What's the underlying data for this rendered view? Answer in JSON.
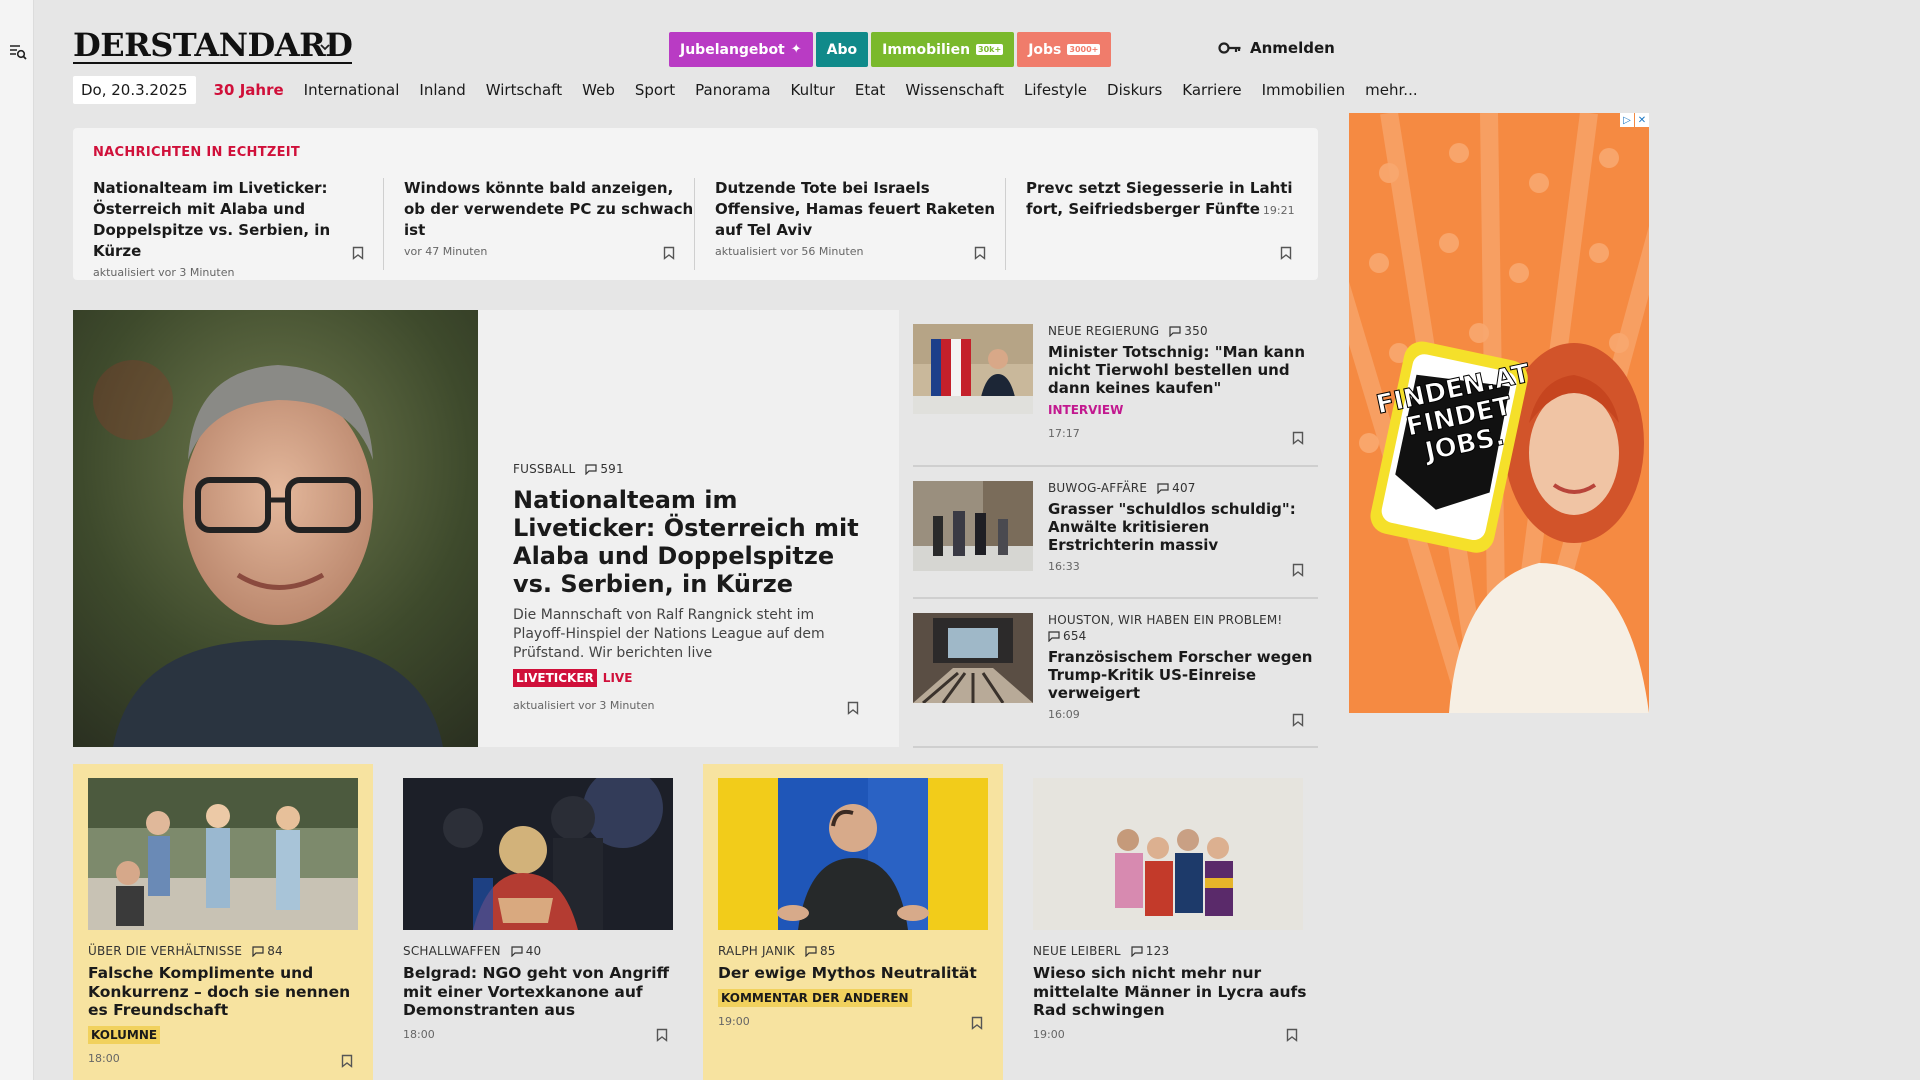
{
  "colors": {
    "accent": "#d0103a",
    "jubel": "#b93bc4",
    "abo": "#108a8a",
    "immo": "#7ab92c",
    "jobs": "#f07c6b",
    "interview": "#c2188f",
    "kolumne_bg": "#f7e3a0"
  },
  "header": {
    "logo": "DERSTANDARD",
    "buttons": {
      "jubel": "Jubelangebot",
      "abo": "Abo",
      "immo": "Immobilien",
      "immo_tag": "30k+",
      "jobs": "Jobs",
      "jobs_tag": "3000+"
    },
    "login": "Anmelden"
  },
  "nav": {
    "date": "Do, 20.3.2025",
    "items": [
      "30 Jahre",
      "International",
      "Inland",
      "Wirtschaft",
      "Web",
      "Sport",
      "Panorama",
      "Kultur",
      "Etat",
      "Wissenschaft",
      "Lifestyle",
      "Diskurs",
      "Karriere",
      "Immobilien",
      "mehr..."
    ]
  },
  "ticker": {
    "heading": "NACHRICHTEN IN ECHTZEIT",
    "items": [
      {
        "title": "Nationalteam im Liveticker: Österreich mit Alaba und Doppelspitze vs. Serbien, in Kürze",
        "meta": "aktualisiert vor 3 Minuten"
      },
      {
        "title": "Windows könnte bald anzeigen, ob der verwendete PC zu schwach ist",
        "meta": "vor 47 Minuten"
      },
      {
        "title": "Dutzende Tote bei Israels Offensive, Hamas feuert Raketen auf Tel Aviv",
        "meta": "aktualisiert vor 56 Minuten"
      },
      {
        "title": "Prevc setzt Siegesserie in Lahti fort, Seifriedsberger Fünfte",
        "meta": "19:21"
      }
    ]
  },
  "hero": {
    "kicker": "FUSSBALL",
    "comments": "591",
    "title": "Nationalteam im Liveticker: Österreich mit Alaba und Doppelspitze vs. Serbien, in Kürze",
    "teaser": "Die Mannschaft von Ralf Rangnick steht im Playoff-Hinspiel der Nations League auf dem Prüfstand. Wir berichten live",
    "badge": "LIVETICKER",
    "live": "LIVE",
    "meta": "aktualisiert vor 3 Minuten"
  },
  "side": [
    {
      "kicker": "NEUE REGIERUNG",
      "comments": "350",
      "title": "Minister Totschnig: \"Man kann nicht Tierwohl bestellen und dann keines kaufen\"",
      "label": "INTERVIEW",
      "time": "17:17"
    },
    {
      "kicker": "BUWOG-AFFÄRE",
      "comments": "407",
      "title": "Grasser \"schuldlos schuldig\": Anwälte kritisieren Erstrichterin massiv",
      "label": "",
      "time": "16:33"
    },
    {
      "kicker": "HOUSTON, WIR HABEN EIN PROBLEM!",
      "comments": "654",
      "title": "Französischem Forscher wegen Trump-Kritik US-Einreise verweigert",
      "label": "",
      "time": "16:09"
    }
  ],
  "cards": [
    {
      "kicker": "ÜBER DIE VERHÄLTNISSE",
      "comments": "84",
      "title": "Falsche Komplimente und Konkurrenz – doch sie nennen es Freundschaft",
      "label": "KOLUMNE",
      "time": "18:00"
    },
    {
      "kicker": "SCHALLWAFFEN",
      "comments": "40",
      "title": "Belgrad: NGO geht von Angriff mit einer Vortexkanone auf Demonstranten aus",
      "label": "",
      "time": "18:00"
    },
    {
      "kicker": "RALPH JANIK",
      "comments": "85",
      "title": "Der ewige Mythos Neutralität",
      "label": "KOMMENTAR DER ANDEREN",
      "time": "19:00"
    },
    {
      "kicker": "NEUE LEIBERL",
      "comments": "123",
      "title": "Wieso sich nicht mehr nur mittelalte Männer in Lycra aufs Rad schwingen",
      "label": "",
      "time": "19:00"
    }
  ],
  "ad": {
    "text": [
      "FINDEN.AT",
      "FINDET",
      "JOBS."
    ]
  }
}
